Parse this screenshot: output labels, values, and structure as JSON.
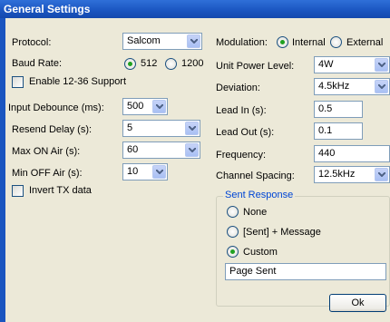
{
  "window": {
    "title": "General Settings"
  },
  "left": {
    "protocol_label": "Protocol:",
    "protocol_value": "Salcom",
    "baud_label": "Baud Rate:",
    "baud_512": "512",
    "baud_1200": "1200",
    "enable_label": "Enable 12-36 Support",
    "debounce_label": "Input Debounce (ms):",
    "debounce_value": "500",
    "resend_label": "Resend Delay (s):",
    "resend_value": "5",
    "maxon_label": "Max ON Air (s):",
    "maxon_value": "60",
    "minoff_label": "Min OFF Air (s):",
    "minoff_value": "10",
    "invert_label": "Invert TX data"
  },
  "right": {
    "modulation_label": "Modulation:",
    "mod_internal": "Internal",
    "mod_external": "External",
    "power_label": "Unit Power Level:",
    "power_value": "4W",
    "deviation_label": "Deviation:",
    "deviation_value": "4.5kHz",
    "leadin_label": "Lead In (s):",
    "leadin_value": "0.5",
    "leadout_label": "Lead Out (s):",
    "leadout_value": "0.1",
    "frequency_label": "Frequency:",
    "frequency_value": "440",
    "spacing_label": "Channel Spacing:",
    "spacing_value": "12.5kHz"
  },
  "sent_response": {
    "title": "Sent Response",
    "opt_none": "None",
    "opt_sent_message": "[Sent] + Message",
    "opt_custom": "Custom",
    "custom_text": "Page Sent"
  },
  "buttons": {
    "ok": "Ok"
  }
}
